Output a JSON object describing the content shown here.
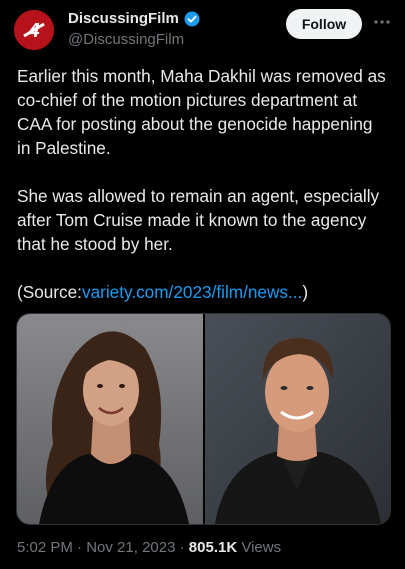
{
  "author": {
    "display_name": "DiscussingFilm",
    "handle": "@DiscussingFilm",
    "avatar_icon": "discussingfilm-logo-icon",
    "verified_icon": "verified-badge-icon",
    "avatar_color": "#b5121b",
    "verified_color": "#1d9bf0"
  },
  "actions": {
    "follow_label": "Follow",
    "more_icon": "more-options-icon"
  },
  "tweet": {
    "paragraph_1": "Earlier this month, Maha Dakhil was removed as co-chief of the motion pictures department at CAA for posting about the genocide happening in Palestine.",
    "paragraph_2": "She was allowed to remain an agent, especially after Tom Cruise made it known to the agency that he stood by her.",
    "source_prefix": "(Source:",
    "source_link": "variety.com/2023/film/news...",
    "source_suffix": ")",
    "link_color": "#1d9bf0"
  },
  "media": {
    "photos": [
      "woman-portrait-photo",
      "man-portrait-photo"
    ]
  },
  "meta": {
    "time": "5:02 PM",
    "separator_1": " · ",
    "date": "Nov 21, 2023",
    "separator_2": " · ",
    "views_count": "805.1K",
    "views_label": " Views"
  }
}
